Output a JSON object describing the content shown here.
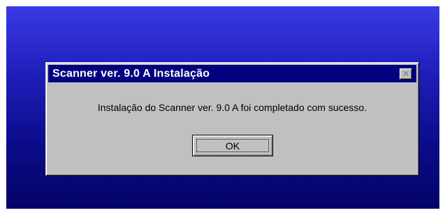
{
  "dialog": {
    "title": "Scanner ver. 9.0 A Instalação",
    "close_icon": "close-icon",
    "close_glyph": "✕",
    "message": "Instalação do Scanner ver. 9.0 A foi completado com sucesso.",
    "ok_label": "OK"
  },
  "colors": {
    "title_bar": "#000080",
    "dialog_face": "#c0c0c0",
    "desktop_gradient_top": "#3a3ae6",
    "desktop_gradient_bottom": "#030366"
  }
}
